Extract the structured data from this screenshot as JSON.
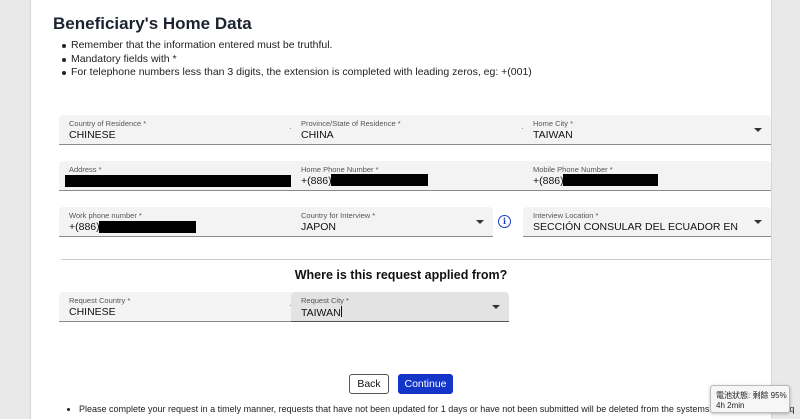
{
  "section": {
    "title": "Beneficiary's Home Data",
    "notes": [
      "Remember that the information entered must be truthful.",
      "Mandatory fields with *",
      "For telephone numbers less than 3 digits, the extension is completed with leading zeros, eg: +(001)"
    ]
  },
  "fields": {
    "country_of_residence": {
      "label": "Country of Residence *",
      "value": "CHINESE"
    },
    "province": {
      "label": "Province/State of Residence *",
      "value": "CHINA"
    },
    "home_city": {
      "label": "Home City *",
      "value": "TAIWAN"
    },
    "address": {
      "label": "Address *",
      "value": ""
    },
    "home_phone": {
      "label": "Home Phone Number *",
      "value": "+(886)"
    },
    "mobile_phone": {
      "label": "Mobile Phone Number *",
      "value": "+(886)"
    },
    "work_phone": {
      "label": "Work phone number *",
      "value": "+(886)"
    },
    "country_interview": {
      "label": "Country for Interview *",
      "value": "JAPON"
    },
    "interview_location": {
      "label": "Interview Location *",
      "value": "SECCIÓN CONSULAR DEL ECUADOR EN"
    }
  },
  "request": {
    "question": "Where is this request applied from?",
    "country": {
      "label": "Request Country *",
      "value": "CHINESE"
    },
    "city": {
      "label": "Request City *",
      "value": "TAIWAN"
    }
  },
  "buttons": {
    "back": "Back",
    "continue": "Continue"
  },
  "footer": {
    "note": "Please complete your request in a timely manner, requests that have not been updated for 1 days or have not been submitted will be deleted from the systems and users will be req"
  },
  "battery": {
    "status": "電池狀態: 剩餘 95%",
    "time": "4h 2min"
  },
  "colors": {
    "primary": "#1336c9",
    "field_bg": "#f3f3f3",
    "active_field_bg": "#e3e3e3"
  },
  "icons": {
    "dropdown": "chevron-down-icon",
    "info": "info-icon"
  }
}
